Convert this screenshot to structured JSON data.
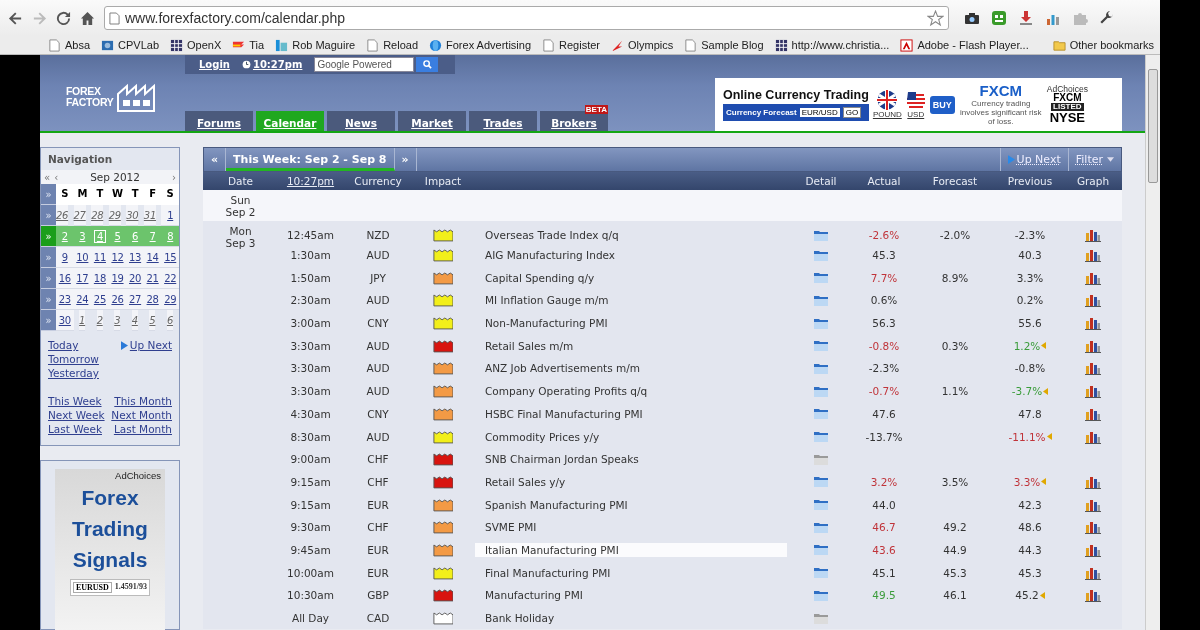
{
  "browser": {
    "url": "www.forexfactory.com/calendar.php",
    "bookmarks": [
      {
        "label": "Absa",
        "kind": "page"
      },
      {
        "label": "CPVLab",
        "kind": "image"
      },
      {
        "label": "OpenX",
        "kind": "grid"
      },
      {
        "label": "Tia",
        "kind": "flag"
      },
      {
        "label": "Rob Maguire",
        "kind": "bar"
      },
      {
        "label": "Reload",
        "kind": "page"
      },
      {
        "label": "Forex Advertising",
        "kind": "globe"
      },
      {
        "label": "Register",
        "kind": "page"
      },
      {
        "label": "Olympics",
        "kind": "swoosh"
      },
      {
        "label": "Sample Blog",
        "kind": "page"
      },
      {
        "label": "http://www.christia...",
        "kind": "grid"
      },
      {
        "label": "Adobe - Flash Player...",
        "kind": "adobe"
      }
    ],
    "other_bookmarks": "Other bookmarks"
  },
  "header": {
    "logo": [
      "FOREX",
      "FACTORY"
    ],
    "login": "Login",
    "time": "10:27pm",
    "search": {
      "placeholder": "Google Powered"
    },
    "tabs": [
      {
        "label": "Forums",
        "selected": false
      },
      {
        "label": "Calendar",
        "selected": true
      },
      {
        "label": "News",
        "selected": false
      },
      {
        "label": "Market",
        "selected": false
      },
      {
        "label": "Trades",
        "selected": false
      },
      {
        "label": "Brokers",
        "selected": false,
        "badge": "BETA"
      }
    ],
    "ad": {
      "title": "Online Currency Trading",
      "forecast_label": "Currency Forecast",
      "pair": "EUR/USD",
      "go": "GO",
      "flags": [
        "POUND",
        "USD"
      ],
      "buy": "BUY",
      "brand": "FXCM",
      "disclaimer": "Currency trading involves significant risk of loss.",
      "adchoices": "AdChoices",
      "listing": [
        "FXCM",
        "LISTED",
        "NYSE"
      ]
    }
  },
  "sidebar": {
    "title": "Navigation",
    "prev_year": "«",
    "prev_month": "‹",
    "month": "Sep 2012",
    "next_month": "›",
    "header_arrow": "»",
    "weekdays": [
      "S",
      "M",
      "T",
      "W",
      "T",
      "F",
      "S"
    ],
    "weeks": [
      {
        "arrow": "»",
        "selected": false,
        "days": [
          {
            "label": "26",
            "other_month": true,
            "today": false
          },
          {
            "label": "27",
            "other_month": true,
            "today": false
          },
          {
            "label": "28",
            "other_month": true,
            "today": false
          },
          {
            "label": "29",
            "other_month": true,
            "today": false
          },
          {
            "label": "30",
            "other_month": true,
            "today": false
          },
          {
            "label": "31",
            "other_month": true,
            "today": false
          },
          {
            "label": "1",
            "other_month": false,
            "today": false
          }
        ]
      },
      {
        "arrow": "»",
        "selected": true,
        "days": [
          {
            "label": "2",
            "other_month": false,
            "today": false
          },
          {
            "label": "3",
            "other_month": false,
            "today": false
          },
          {
            "label": "4",
            "other_month": false,
            "today": true
          },
          {
            "label": "5",
            "other_month": false,
            "today": false
          },
          {
            "label": "6",
            "other_month": false,
            "today": false
          },
          {
            "label": "7",
            "other_month": false,
            "today": false
          },
          {
            "label": "8",
            "other_month": false,
            "today": false
          }
        ]
      },
      {
        "arrow": "»",
        "selected": false,
        "days": [
          {
            "label": "9",
            "other_month": false,
            "today": false
          },
          {
            "label": "10",
            "other_month": false,
            "today": false
          },
          {
            "label": "11",
            "other_month": false,
            "today": false
          },
          {
            "label": "12",
            "other_month": false,
            "today": false
          },
          {
            "label": "13",
            "other_month": false,
            "today": false
          },
          {
            "label": "14",
            "other_month": false,
            "today": false
          },
          {
            "label": "15",
            "other_month": false,
            "today": false
          }
        ]
      },
      {
        "arrow": "»",
        "selected": false,
        "days": [
          {
            "label": "16",
            "other_month": false,
            "today": false
          },
          {
            "label": "17",
            "other_month": false,
            "today": false
          },
          {
            "label": "18",
            "other_month": false,
            "today": false
          },
          {
            "label": "19",
            "other_month": false,
            "today": false
          },
          {
            "label": "20",
            "other_month": false,
            "today": false
          },
          {
            "label": "21",
            "other_month": false,
            "today": false
          },
          {
            "label": "22",
            "other_month": false,
            "today": false
          }
        ]
      },
      {
        "arrow": "»",
        "selected": false,
        "days": [
          {
            "label": "23",
            "other_month": false,
            "today": false
          },
          {
            "label": "24",
            "other_month": false,
            "today": false
          },
          {
            "label": "25",
            "other_month": false,
            "today": false
          },
          {
            "label": "26",
            "other_month": false,
            "today": false
          },
          {
            "label": "27",
            "other_month": false,
            "today": false
          },
          {
            "label": "28",
            "other_month": false,
            "today": false
          },
          {
            "label": "29",
            "other_month": false,
            "today": false
          }
        ]
      },
      {
        "arrow": "»",
        "selected": false,
        "days": [
          {
            "label": "30",
            "other_month": false,
            "today": false
          },
          {
            "label": "1",
            "other_month": true,
            "today": false
          },
          {
            "label": "2",
            "other_month": true,
            "today": false
          },
          {
            "label": "3",
            "other_month": true,
            "today": false
          },
          {
            "label": "4",
            "other_month": true,
            "today": false
          },
          {
            "label": "5",
            "other_month": true,
            "today": false
          },
          {
            "label": "6",
            "other_month": true,
            "today": false
          }
        ]
      }
    ],
    "quick_links": [
      [
        {
          "label": "Today"
        },
        {
          "label": "Up Next",
          "icon": true
        }
      ],
      [
        {
          "label": "Tomorrow"
        }
      ],
      [
        {
          "label": "Yesterday"
        }
      ]
    ],
    "period_links": [
      [
        {
          "label": "This Week"
        },
        {
          "label": "This Month"
        }
      ],
      [
        {
          "label": "Next Week"
        },
        {
          "label": "Next Month"
        }
      ],
      [
        {
          "label": "Last Week"
        },
        {
          "label": "Last Month"
        }
      ]
    ],
    "ad": {
      "adchoices": "AdChoices",
      "headline": "Forex Trading Signals",
      "pair": "EURUSD",
      "quote": "1.4591/93"
    }
  },
  "calendar": {
    "prev_week": "«",
    "week": "This Week: Sep 2 - Sep 8",
    "next_week": "»",
    "up_next": "Up Next",
    "filter": "Filter",
    "columns": [
      "Date",
      "10:27pm",
      "Currency",
      "Impact",
      "Detail",
      "Actual",
      "Forecast",
      "Previous",
      "Graph"
    ],
    "days": [
      {
        "day": "Sun",
        "date": "Sep 2"
      },
      {
        "day": "Mon",
        "date": "Sep 3",
        "rows": [
          {
            "time": "12:45am",
            "currency": "NZD",
            "impact": {
              "color": "#f2ef1a"
            },
            "event": "Overseas Trade Index q/q",
            "actual": {
              "text": "-2.6%",
              "color": "#c0343a"
            },
            "forecast": "-2.0%",
            "previous": {
              "text": "-2.3%",
              "color": "#333333"
            },
            "graph": true
          },
          {
            "time": "1:30am",
            "currency": "AUD",
            "impact": {
              "color": "#f2ef1a"
            },
            "event": "AIG Manufacturing Index",
            "actual": {
              "text": "45.3",
              "color": "#333333"
            },
            "previous": {
              "text": "40.3",
              "color": "#333333"
            },
            "graph": true
          },
          {
            "time": "1:50am",
            "currency": "JPY",
            "impact": {
              "color": "#f39a45"
            },
            "event": "Capital Spending q/y",
            "actual": {
              "text": "7.7%",
              "color": "#c0343a"
            },
            "forecast": "8.9%",
            "previous": {
              "text": "3.3%",
              "color": "#333333"
            },
            "graph": true
          },
          {
            "time": "2:30am",
            "currency": "AUD",
            "impact": {
              "color": "#f2ef1a"
            },
            "event": "MI Inflation Gauge m/m",
            "actual": {
              "text": "0.6%",
              "color": "#333333"
            },
            "previous": {
              "text": "0.2%",
              "color": "#333333"
            },
            "graph": true
          },
          {
            "time": "3:00am",
            "currency": "CNY",
            "impact": {
              "color": "#f2ef1a"
            },
            "event": "Non-Manufacturing PMI",
            "actual": {
              "text": "56.3",
              "color": "#333333"
            },
            "previous": {
              "text": "55.6",
              "color": "#333333"
            },
            "graph": true
          },
          {
            "time": "3:30am",
            "currency": "AUD",
            "impact": {
              "color": "#d8140f"
            },
            "event": "Retail Sales m/m",
            "actual": {
              "text": "-0.8%",
              "color": "#c0343a"
            },
            "forecast": "0.3%",
            "previous": {
              "text": "1.2%",
              "color": "#3a9c3a"
            },
            "revised": true,
            "graph": true
          },
          {
            "time": "3:30am",
            "currency": "AUD",
            "impact": {
              "color": "#f39a45"
            },
            "event": "ANZ Job Advertisements m/m",
            "actual": {
              "text": "-2.3%",
              "color": "#333333"
            },
            "previous": {
              "text": "-0.8%",
              "color": "#333333"
            },
            "graph": true
          },
          {
            "time": "3:30am",
            "currency": "AUD",
            "impact": {
              "color": "#f39a45"
            },
            "event": "Company Operating Profits q/q",
            "actual": {
              "text": "-0.7%",
              "color": "#c0343a"
            },
            "forecast": "1.1%",
            "previous": {
              "text": "-3.7%",
              "color": "#3a9c3a"
            },
            "revised": true,
            "graph": true
          },
          {
            "time": "4:30am",
            "currency": "CNY",
            "impact": {
              "color": "#f39a45"
            },
            "event": "HSBC Final Manufacturing PMI",
            "actual": {
              "text": "47.6",
              "color": "#333333"
            },
            "previous": {
              "text": "47.8",
              "color": "#333333"
            },
            "graph": true
          },
          {
            "time": "8:30am",
            "currency": "AUD",
            "impact": {
              "color": "#f2ef1a"
            },
            "event": "Commodity Prices y/y",
            "actual": {
              "text": "-13.7%",
              "color": "#333333"
            },
            "previous": {
              "text": "-11.1%",
              "color": "#c0343a"
            },
            "revised": true,
            "graph": true
          },
          {
            "time": "9:00am",
            "currency": "CHF",
            "impact": {
              "color": "#d8140f"
            },
            "event": "SNB Chairman Jordan Speaks",
            "graph": false
          },
          {
            "time": "9:15am",
            "currency": "CHF",
            "impact": {
              "color": "#d8140f"
            },
            "event": "Retail Sales y/y",
            "actual": {
              "text": "3.2%",
              "color": "#c0343a"
            },
            "forecast": "3.5%",
            "previous": {
              "text": "3.3%",
              "color": "#c0343a"
            },
            "revised": true,
            "graph": true
          },
          {
            "time": "9:15am",
            "currency": "EUR",
            "impact": {
              "color": "#f39a45"
            },
            "event": "Spanish Manufacturing PMI",
            "actual": {
              "text": "44.0",
              "color": "#333333"
            },
            "previous": {
              "text": "42.3",
              "color": "#333333"
            },
            "graph": true
          },
          {
            "time": "9:30am",
            "currency": "CHF",
            "impact": {
              "color": "#f39a45"
            },
            "event": "SVME PMI",
            "actual": {
              "text": "46.7",
              "color": "#c0343a"
            },
            "forecast": "49.2",
            "previous": {
              "text": "48.6",
              "color": "#333333"
            },
            "graph": true
          },
          {
            "time": "9:45am",
            "currency": "EUR",
            "impact": {
              "color": "#f39a45"
            },
            "event": "Italian Manufacturing PMI",
            "highlighted": true,
            "actual": {
              "text": "43.6",
              "color": "#c0343a"
            },
            "forecast": "44.9",
            "previous": {
              "text": "44.3",
              "color": "#333333"
            },
            "graph": true
          },
          {
            "time": "10:00am",
            "currency": "EUR",
            "impact": {
              "color": "#f2ef1a"
            },
            "event": "Final Manufacturing PMI",
            "actual": {
              "text": "45.1",
              "color": "#333333"
            },
            "forecast": "45.3",
            "previous": {
              "text": "45.3",
              "color": "#333333"
            },
            "graph": true
          },
          {
            "time": "10:30am",
            "currency": "GBP",
            "impact": {
              "color": "#d8140f"
            },
            "event": "Manufacturing PMI",
            "actual": {
              "text": "49.5",
              "color": "#3a9c3a"
            },
            "forecast": "46.1",
            "previous": {
              "text": "45.2",
              "color": "#333333"
            },
            "revised": true,
            "graph": true
          },
          {
            "time": "All Day",
            "currency": "CAD",
            "impact": {
              "color": "#ffffff"
            },
            "event": "Bank Holiday",
            "graph": false
          }
        ]
      }
    ]
  }
}
